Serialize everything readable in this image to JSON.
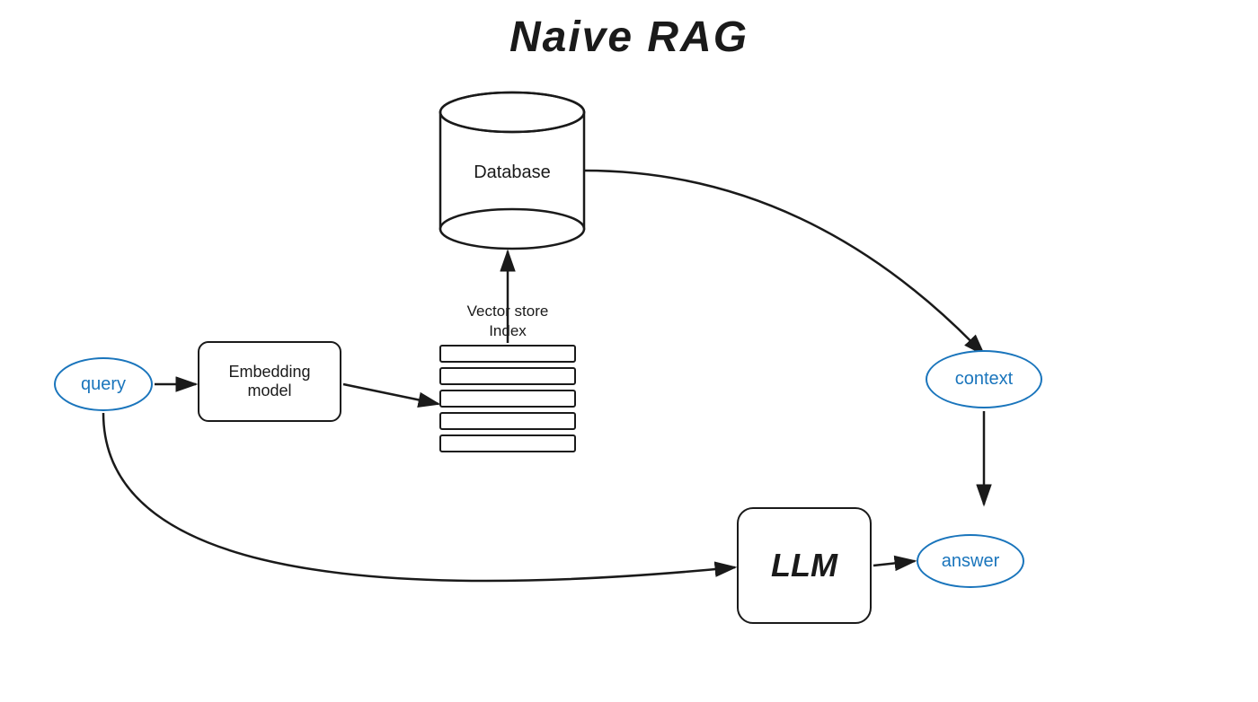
{
  "title": "Naive RAG",
  "nodes": {
    "query": "query",
    "context": "context",
    "answer": "answer",
    "embedding": "Embedding\nmodel",
    "llm": "LLM",
    "database": "Database",
    "vector_store_label": "Vector store\nIndex"
  },
  "colors": {
    "blue": "#1a75bc",
    "black": "#1a1a1a",
    "background": "#ffffff"
  }
}
